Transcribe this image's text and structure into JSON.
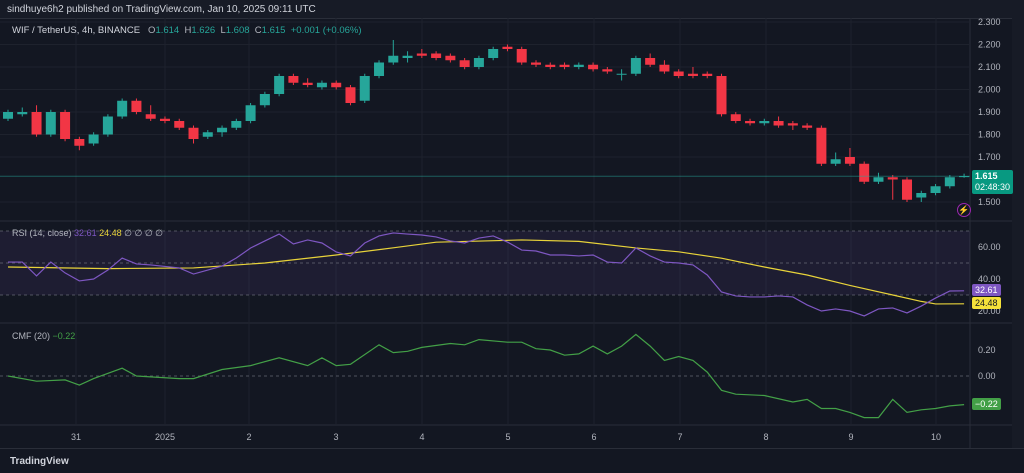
{
  "header": {
    "published": "sindhuye6h2 published on TradingView.com, Jan 10, 2025 09:11 UTC"
  },
  "legend": {
    "symbol": "WIF / TetherUS, 4h, BINANCE",
    "o_label": "O",
    "o": "1.614",
    "h_label": "H",
    "h": "1.626",
    "l_label": "L",
    "l": "1.608",
    "c_label": "C",
    "c": "1.615",
    "change": "+0.001 (+0.06%)"
  },
  "price_tag": {
    "price": "1.615",
    "countdown": "02:48:30"
  },
  "rsi_legend": {
    "name": "RSI (14, close)",
    "rsi": "32.61",
    "ma": "24.48",
    "na": "∅ ∅ ∅ ∅"
  },
  "cmf_legend": {
    "name": "CMF (20)",
    "value": "−0.22"
  },
  "tags": {
    "rsi": "32.61",
    "ma": "24.48",
    "cmf": "−0.22"
  },
  "colors": {
    "up": "#26a69a",
    "down": "#f23645",
    "rsi": "#7e57c2",
    "rsi_ma": "#e8d33a",
    "cmf": "#43a047"
  },
  "brand": "TradingView",
  "chart_data": [
    {
      "type": "candlestick",
      "title": "WIF / TetherUS, 4h, BINANCE",
      "ylim": [
        1.45,
        2.3
      ],
      "yticks": [
        "2.300",
        "2.200",
        "2.100",
        "2.000",
        "1.900",
        "1.800",
        "1.700",
        "1.500"
      ],
      "xticks": [
        "31",
        "2025",
        "2",
        "3",
        "4",
        "5",
        "6",
        "7",
        "8",
        "9",
        "10"
      ],
      "ohlc": [
        [
          1.87,
          1.91,
          1.86,
          1.9
        ],
        [
          1.89,
          1.92,
          1.88,
          1.9
        ],
        [
          1.9,
          1.93,
          1.79,
          1.8
        ],
        [
          1.8,
          1.91,
          1.79,
          1.9
        ],
        [
          1.9,
          1.91,
          1.77,
          1.78
        ],
        [
          1.78,
          1.79,
          1.73,
          1.75
        ],
        [
          1.76,
          1.81,
          1.75,
          1.8
        ],
        [
          1.8,
          1.89,
          1.79,
          1.88
        ],
        [
          1.88,
          1.96,
          1.87,
          1.95
        ],
        [
          1.95,
          1.96,
          1.89,
          1.9
        ],
        [
          1.89,
          1.93,
          1.86,
          1.87
        ],
        [
          1.87,
          1.88,
          1.85,
          1.86
        ],
        [
          1.86,
          1.87,
          1.82,
          1.83
        ],
        [
          1.83,
          1.84,
          1.76,
          1.78
        ],
        [
          1.79,
          1.82,
          1.78,
          1.81
        ],
        [
          1.81,
          1.84,
          1.79,
          1.83
        ],
        [
          1.83,
          1.87,
          1.82,
          1.86
        ],
        [
          1.86,
          1.94,
          1.85,
          1.93
        ],
        [
          1.93,
          1.99,
          1.92,
          1.98
        ],
        [
          1.98,
          2.07,
          1.97,
          2.06
        ],
        [
          2.06,
          2.07,
          2.02,
          2.03
        ],
        [
          2.03,
          2.05,
          2.01,
          2.02
        ],
        [
          2.01,
          2.04,
          2.0,
          2.03
        ],
        [
          2.03,
          2.04,
          2.0,
          2.01
        ],
        [
          2.01,
          2.02,
          1.93,
          1.94
        ],
        [
          1.95,
          2.07,
          1.94,
          2.06
        ],
        [
          2.06,
          2.13,
          2.05,
          2.12
        ],
        [
          2.12,
          2.22,
          2.11,
          2.15
        ],
        [
          2.14,
          2.17,
          2.12,
          2.15
        ],
        [
          2.16,
          2.18,
          2.14,
          2.15
        ],
        [
          2.16,
          2.17,
          2.13,
          2.14
        ],
        [
          2.15,
          2.16,
          2.12,
          2.13
        ],
        [
          2.13,
          2.14,
          2.09,
          2.1
        ],
        [
          2.1,
          2.15,
          2.09,
          2.14
        ],
        [
          2.14,
          2.19,
          2.13,
          2.18
        ],
        [
          2.19,
          2.2,
          2.17,
          2.18
        ],
        [
          2.18,
          2.19,
          2.11,
          2.12
        ],
        [
          2.12,
          2.13,
          2.1,
          2.11
        ],
        [
          2.11,
          2.12,
          2.09,
          2.1
        ],
        [
          2.11,
          2.12,
          2.09,
          2.1
        ],
        [
          2.1,
          2.12,
          2.09,
          2.11
        ],
        [
          2.11,
          2.12,
          2.08,
          2.09
        ],
        [
          2.09,
          2.1,
          2.07,
          2.08
        ],
        [
          2.07,
          2.09,
          2.04,
          2.07
        ],
        [
          2.07,
          2.15,
          2.06,
          2.14
        ],
        [
          2.14,
          2.16,
          2.1,
          2.11
        ],
        [
          2.11,
          2.13,
          2.07,
          2.08
        ],
        [
          2.08,
          2.09,
          2.05,
          2.06
        ],
        [
          2.07,
          2.1,
          2.05,
          2.06
        ],
        [
          2.07,
          2.08,
          2.05,
          2.06
        ],
        [
          2.06,
          2.07,
          1.88,
          1.89
        ],
        [
          1.89,
          1.9,
          1.85,
          1.86
        ],
        [
          1.86,
          1.87,
          1.84,
          1.85
        ],
        [
          1.85,
          1.87,
          1.84,
          1.86
        ],
        [
          1.86,
          1.88,
          1.83,
          1.84
        ],
        [
          1.85,
          1.86,
          1.82,
          1.84
        ],
        [
          1.84,
          1.85,
          1.82,
          1.83
        ],
        [
          1.83,
          1.84,
          1.66,
          1.67
        ],
        [
          1.67,
          1.72,
          1.66,
          1.69
        ],
        [
          1.7,
          1.74,
          1.66,
          1.67
        ],
        [
          1.67,
          1.68,
          1.58,
          1.59
        ],
        [
          1.59,
          1.63,
          1.58,
          1.61
        ],
        [
          1.61,
          1.62,
          1.51,
          1.6
        ],
        [
          1.6,
          1.61,
          1.5,
          1.51
        ],
        [
          1.52,
          1.55,
          1.5,
          1.54
        ],
        [
          1.54,
          1.58,
          1.53,
          1.57
        ],
        [
          1.57,
          1.62,
          1.56,
          1.61
        ],
        [
          1.614,
          1.626,
          1.608,
          1.615
        ]
      ]
    },
    {
      "type": "line",
      "title": "RSI (14, close)",
      "ylim": [
        15,
        72
      ],
      "yticks": [
        "60.00",
        "40.00",
        "20.00"
      ],
      "bands": [
        70,
        50,
        30
      ],
      "series": [
        {
          "name": "RSI",
          "values": [
            [
              0,
              50.6
            ],
            [
              1,
              50.6
            ],
            [
              2,
              41.9
            ],
            [
              3,
              50.6
            ],
            [
              4,
              43.8
            ],
            [
              5,
              38.8
            ],
            [
              6,
              40
            ],
            [
              7,
              45.6
            ],
            [
              8,
              53.1
            ],
            [
              9,
              49.4
            ],
            [
              10,
              48.8
            ],
            [
              12,
              46.9
            ],
            [
              13,
              43.1
            ],
            [
              14,
              45.6
            ],
            [
              15,
              48.1
            ],
            [
              16,
              53.1
            ],
            [
              17,
              59.4
            ],
            [
              18,
              63.8
            ],
            [
              19,
              68.1
            ],
            [
              20,
              61.9
            ],
            [
              21,
              64.4
            ],
            [
              22,
              62.5
            ],
            [
              23,
              56.9
            ],
            [
              24,
              54.4
            ],
            [
              25,
              62.5
            ],
            [
              26,
              66.9
            ],
            [
              27,
              68.8
            ],
            [
              28,
              68.1
            ],
            [
              29,
              67.5
            ],
            [
              30,
              66.3
            ],
            [
              31,
              63.8
            ],
            [
              32,
              62.5
            ],
            [
              33,
              65.6
            ],
            [
              34,
              66.9
            ],
            [
              35,
              63.1
            ],
            [
              36,
              58.1
            ],
            [
              37,
              57.5
            ],
            [
              38,
              55
            ],
            [
              39,
              55
            ],
            [
              40,
              54.4
            ],
            [
              41,
              55
            ],
            [
              42,
              50.6
            ],
            [
              43,
              50
            ],
            [
              44,
              59.4
            ],
            [
              45,
              54.4
            ],
            [
              46,
              50.6
            ],
            [
              47,
              50
            ],
            [
              48,
              48.8
            ],
            [
              49,
              42.5
            ],
            [
              50,
              31.9
            ],
            [
              51,
              29.4
            ],
            [
              52,
              28.8
            ],
            [
              53,
              28.8
            ],
            [
              54,
              29.4
            ],
            [
              55,
              28.8
            ],
            [
              56,
              23.8
            ],
            [
              57,
              20
            ],
            [
              58,
              21.3
            ],
            [
              59,
              20
            ],
            [
              60,
              16.9
            ],
            [
              61,
              21.3
            ],
            [
              62,
              21.9
            ],
            [
              63,
              18.8
            ],
            [
              64,
              23.1
            ],
            [
              65,
              28.1
            ],
            [
              66,
              32.5
            ],
            [
              67,
              32.61
            ]
          ]
        },
        {
          "name": "RSI-based MA",
          "values": [
            [
              0,
              47.5
            ],
            [
              7,
              46.5
            ],
            [
              13,
              46.9
            ],
            [
              18,
              50
            ],
            [
              23,
              55
            ],
            [
              27,
              59.5
            ],
            [
              30,
              63
            ],
            [
              36,
              64.4
            ],
            [
              40,
              63.5
            ],
            [
              44,
              59.4
            ],
            [
              47,
              57
            ],
            [
              50,
              53
            ],
            [
              53,
              47.5
            ],
            [
              56,
              42.5
            ],
            [
              59,
              36
            ],
            [
              62,
              30
            ],
            [
              64,
              26
            ],
            [
              65,
              24.4
            ],
            [
              67,
              24.48
            ]
          ]
        }
      ]
    },
    {
      "type": "line",
      "title": "CMF (20)",
      "ylim": [
        -0.35,
        0.38
      ],
      "yticks": [
        "0.20",
        "0.00"
      ],
      "series": [
        {
          "name": "CMF",
          "values": [
            [
              0,
              0
            ],
            [
              2,
              -0.04
            ],
            [
              4,
              -0.03
            ],
            [
              5,
              -0.07
            ],
            [
              6,
              -0.02
            ],
            [
              8,
              0.06
            ],
            [
              9,
              0
            ],
            [
              12,
              -0.02
            ],
            [
              13,
              -0.02
            ],
            [
              15,
              0.05
            ],
            [
              17,
              0.08
            ],
            [
              19,
              0.14
            ],
            [
              21,
              0.08
            ],
            [
              22,
              0.14
            ],
            [
              23,
              0.08
            ],
            [
              24,
              0.09
            ],
            [
              26,
              0.24
            ],
            [
              27,
              0.18
            ],
            [
              28,
              0.19
            ],
            [
              29,
              0.22
            ],
            [
              31,
              0.25
            ],
            [
              32,
              0.24
            ],
            [
              33,
              0.28
            ],
            [
              35,
              0.26
            ],
            [
              36,
              0.26
            ],
            [
              37,
              0.21
            ],
            [
              38,
              0.2
            ],
            [
              39,
              0.16
            ],
            [
              40,
              0.17
            ],
            [
              41,
              0.23
            ],
            [
              42,
              0.17
            ],
            [
              43,
              0.23
            ],
            [
              44,
              0.32
            ],
            [
              45,
              0.23
            ],
            [
              46,
              0.12
            ],
            [
              47,
              0.15
            ],
            [
              48,
              0.12
            ],
            [
              49,
              0.03
            ],
            [
              50,
              -0.11
            ],
            [
              51,
              -0.14
            ],
            [
              53,
              -0.15
            ],
            [
              55,
              -0.2
            ],
            [
              56,
              -0.18
            ],
            [
              57,
              -0.25
            ],
            [
              58,
              -0.25
            ],
            [
              59,
              -0.28
            ],
            [
              60,
              -0.32
            ],
            [
              61,
              -0.32
            ],
            [
              62,
              -0.18
            ],
            [
              63,
              -0.28
            ],
            [
              64,
              -0.26
            ],
            [
              65,
              -0.25
            ],
            [
              66,
              -0.23
            ],
            [
              67,
              -0.22
            ]
          ]
        }
      ]
    }
  ]
}
